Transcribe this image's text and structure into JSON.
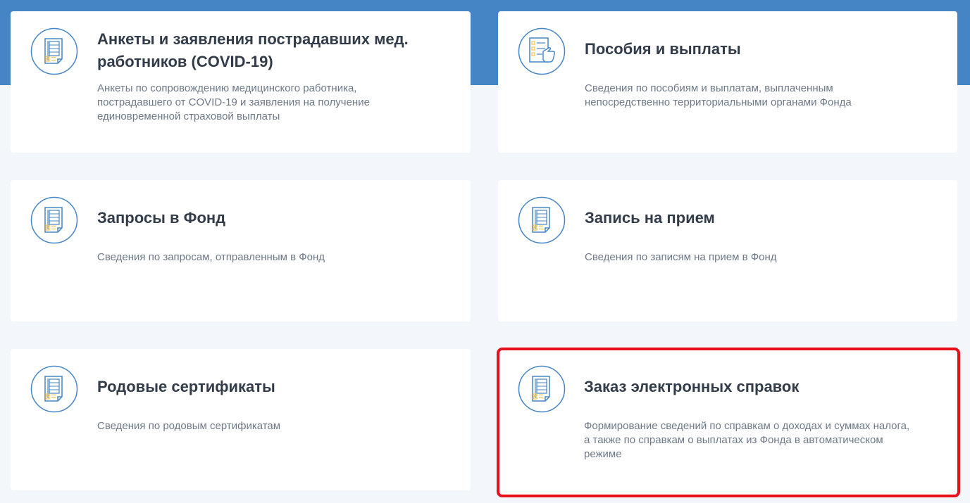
{
  "cards": [
    {
      "icon": "document-list-icon",
      "title": "Анкеты и заявления пострадавших мед. работников (COVID-19)",
      "description": "Анкеты по сопровождению медицинского работника, пострадавшего от COVID-19 и заявления на получение единовременной страховой выплаты"
    },
    {
      "icon": "checklist-hand-icon",
      "title": "Пособия и выплаты",
      "description": "Сведения по пособиям и выплатам, выплаченным непосредственно территориальными органами Фонда"
    },
    {
      "icon": "document-list-icon",
      "title": "Запросы в Фонд",
      "description": "Сведения по запросам, отправленным в Фонд"
    },
    {
      "icon": "document-list-icon",
      "title": "Запись на прием",
      "description": "Сведения по записям на прием в Фонд"
    },
    {
      "icon": "document-list-icon",
      "title": "Родовые сертификаты",
      "description": "Сведения по родовым сертификатам"
    },
    {
      "icon": "document-list-icon",
      "title": "Заказ электронных справок",
      "description": "Формирование сведений по справкам о доходах и суммах налога, а также по справкам о выплатах из Фонда в автоматическом режиме"
    }
  ],
  "colors": {
    "header_band": "#4585c6",
    "page_background": "#f3f6fa",
    "icon_stroke": "#4585c6",
    "icon_accent": "#f2c14e",
    "highlight_border": "#e8101a"
  }
}
